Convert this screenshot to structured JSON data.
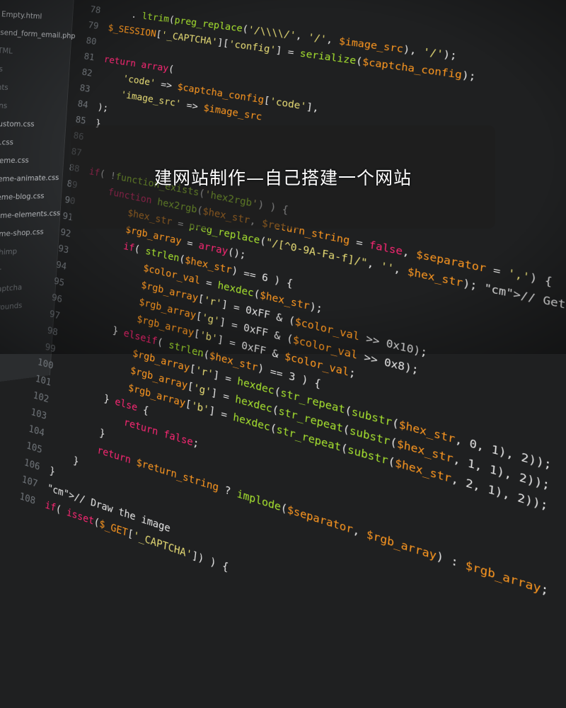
{
  "overlay": {
    "title": "建网站制作—自己搭建一个网站"
  },
  "sidebar": {
    "items": [
      "Empty.html",
      "send_form_email.php",
      "HTML",
      "css",
      "fonts",
      "skins",
      "custom.css",
      "ie.css",
      "theme.css",
      "theme-animate.css",
      "theme-blog.css",
      "theme-elements.css",
      "theme-shop.css",
      "mailchimp",
      "mailer",
      "php-captcha",
      "backgrounds"
    ]
  },
  "code": {
    "lines": [
      {
        "n": "78",
        "t": "    . ltrim(preg_replace('/\\\\\\\\/', '/', $image_src), '/');"
      },
      {
        "n": "79",
        "t": "$_SESSION['_CAPTCHA']['config'] = serialize($captcha_config);"
      },
      {
        "n": "80",
        "t": ""
      },
      {
        "n": "81",
        "t": "return array("
      },
      {
        "n": "82",
        "t": "    'code' => $captcha_config['code'],"
      },
      {
        "n": "83",
        "t": "    'image_src' => $image_src"
      },
      {
        "n": "84",
        "t": ");"
      },
      {
        "n": "85",
        "t": "}"
      },
      {
        "n": "86",
        "t": ""
      },
      {
        "n": "87",
        "t": ""
      },
      {
        "n": "88",
        "t": "if( !function_exists('hex2rgb') ) {"
      },
      {
        "n": "89",
        "t": "    function hex2rgb($hex_str, $return_string = false, $separator = ',') {"
      },
      {
        "n": "90",
        "t": "        $hex_str = preg_replace(\"/[^0-9A-Fa-f]/\", '', $hex_str); // Gets a proper hex string"
      },
      {
        "n": "91",
        "t": "        $rgb_array = array();"
      },
      {
        "n": "92",
        "t": "        if( strlen($hex_str) == 6 ) {"
      },
      {
        "n": "93",
        "t": "            $color_val = hexdec($hex_str);"
      },
      {
        "n": "94",
        "t": "            $rgb_array['r'] = 0xFF & ($color_val >> 0x10);"
      },
      {
        "n": "95",
        "t": "            $rgb_array['g'] = 0xFF & ($color_val >> 0x8);"
      },
      {
        "n": "96",
        "t": "            $rgb_array['b'] = 0xFF & $color_val;"
      },
      {
        "n": "97",
        "t": "        } elseif( strlen($hex_str) == 3 ) {"
      },
      {
        "n": "98",
        "t": "            $rgb_array['r'] = hexdec(str_repeat(substr($hex_str, 0, 1), 2));"
      },
      {
        "n": "99",
        "t": "            $rgb_array['g'] = hexdec(str_repeat(substr($hex_str, 1, 1), 2));"
      },
      {
        "n": "100",
        "t": "            $rgb_array['b'] = hexdec(str_repeat(substr($hex_str, 2, 1), 2));"
      },
      {
        "n": "101",
        "t": "        } else {"
      },
      {
        "n": "102",
        "t": "            return false;"
      },
      {
        "n": "103",
        "t": "        }"
      },
      {
        "n": "104",
        "t": "        return $return_string ? implode($separator, $rgb_array) : $rgb_array;"
      },
      {
        "n": "105",
        "t": "    }"
      },
      {
        "n": "106",
        "t": "}"
      },
      {
        "n": "107",
        "t": "// Draw the image"
      },
      {
        "n": "108",
        "t": "if( isset($_GET['_CAPTCHA']) ) {"
      }
    ]
  },
  "colors": {
    "keyword": "#f92672",
    "function": "#a6e22e",
    "string": "#e6db74",
    "variable": "#fd971f",
    "comment": "#75715e",
    "background": "#1f2021"
  }
}
